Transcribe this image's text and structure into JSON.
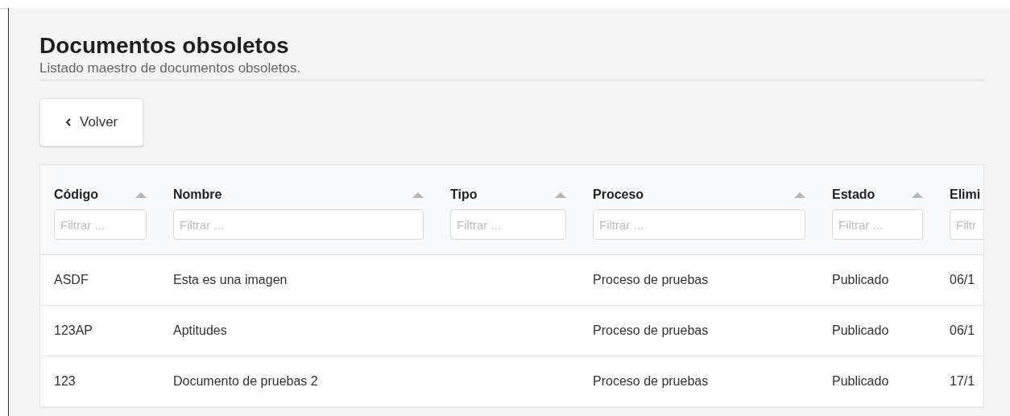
{
  "page": {
    "title": "Documentos obsoletos",
    "subtitle": "Listado maestro de documentos obsoletos."
  },
  "back_button": {
    "label": "Volver"
  },
  "table": {
    "columns": [
      {
        "label": "Código",
        "placeholder": "Filtrar ...",
        "sortable": true
      },
      {
        "label": "Nombre",
        "placeholder": "Filtrar ...",
        "sortable": true
      },
      {
        "label": "Tipo",
        "placeholder": "Filtrar ...",
        "sortable": true
      },
      {
        "label": "Proceso",
        "placeholder": "Filtrar ...",
        "sortable": true
      },
      {
        "label": "Estado",
        "placeholder": "Filtrar ...",
        "sortable": true
      },
      {
        "label": "Elimi",
        "placeholder": "Filtr",
        "sortable": false
      }
    ],
    "rows": [
      [
        "ASDF",
        "Esta es una imagen",
        "",
        "Proceso de pruebas",
        "Publicado",
        "06/1"
      ],
      [
        "123AP",
        "Aptitudes",
        "",
        "Proceso de pruebas",
        "Publicado",
        "06/1"
      ],
      [
        "123",
        "Documento de pruebas 2",
        "",
        "Proceso de pruebas",
        "Publicado",
        "17/1"
      ]
    ]
  }
}
